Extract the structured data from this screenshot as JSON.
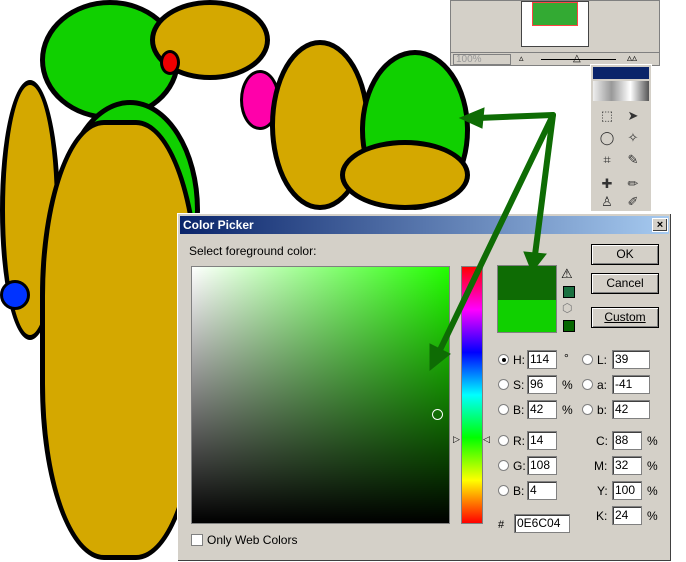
{
  "navigator": {
    "zoom": "100%"
  },
  "dialog": {
    "title": "Color Picker",
    "close_label": "×",
    "prompt": "Select foreground color:",
    "buttons": {
      "ok": "OK",
      "cancel": "Cancel",
      "custom": "Custom"
    },
    "colors": {
      "new": "#0E6C04",
      "old": "#10D000",
      "hue_base": "#22FF00"
    },
    "fields": {
      "hsb": [
        {
          "label": "H:",
          "value": "114",
          "unit": "°",
          "selected": true
        },
        {
          "label": "S:",
          "value": "96",
          "unit": "%",
          "selected": false
        },
        {
          "label": "B:",
          "value": "42",
          "unit": "%",
          "selected": false
        }
      ],
      "lab": [
        {
          "label": "L:",
          "value": "39"
        },
        {
          "label": "a:",
          "value": "-41"
        },
        {
          "label": "b:",
          "value": "42"
        }
      ],
      "rgb": [
        {
          "label": "R:",
          "value": "14"
        },
        {
          "label": "G:",
          "value": "108"
        },
        {
          "label": "B:",
          "value": "4"
        }
      ],
      "cmyk": [
        {
          "label": "C:",
          "value": "88",
          "unit": "%"
        },
        {
          "label": "M:",
          "value": "32",
          "unit": "%"
        },
        {
          "label": "Y:",
          "value": "100",
          "unit": "%"
        },
        {
          "label": "K:",
          "value": "24",
          "unit": "%"
        }
      ],
      "hex_label": "#",
      "hex": "0E6C04"
    },
    "web_only_label": "Only Web Colors"
  },
  "icons": {
    "gamut_warning": "warning-icon",
    "web_safe": "cube-icon"
  }
}
